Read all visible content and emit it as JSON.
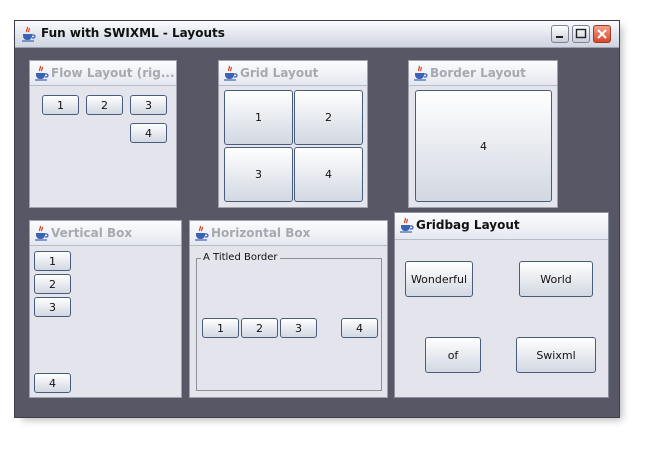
{
  "window": {
    "title": "Fun with SWIXML - Layouts"
  },
  "frames": {
    "flow": {
      "title": "Flow Layout (rig...",
      "buttons": [
        "1",
        "2",
        "3",
        "4"
      ]
    },
    "grid": {
      "title": "Grid Layout",
      "buttons": [
        "1",
        "2",
        "3",
        "4"
      ]
    },
    "border": {
      "title": "Border Layout",
      "buttons": [
        "4"
      ]
    },
    "vbox": {
      "title": "Vertical Box",
      "buttons": [
        "1",
        "2",
        "3",
        "4"
      ]
    },
    "hbox": {
      "title": "Horizontal Box",
      "border_title": "A Titled Border",
      "buttons": [
        "1",
        "2",
        "3",
        "4"
      ]
    },
    "gridbag": {
      "title": "Gridbag Layout",
      "buttons": [
        "Wonderful",
        "World",
        "of",
        "Swixml"
      ]
    }
  },
  "icons": {
    "frame_icon": "java-cup-icon",
    "minimize": "minimize-icon",
    "maximize": "maximize-icon",
    "close": "close-icon"
  },
  "colors": {
    "desktop": "#585765",
    "frame_bg": "#e4e4ec",
    "button_border": "#4a5c7c",
    "close_red": "#d8472a"
  }
}
